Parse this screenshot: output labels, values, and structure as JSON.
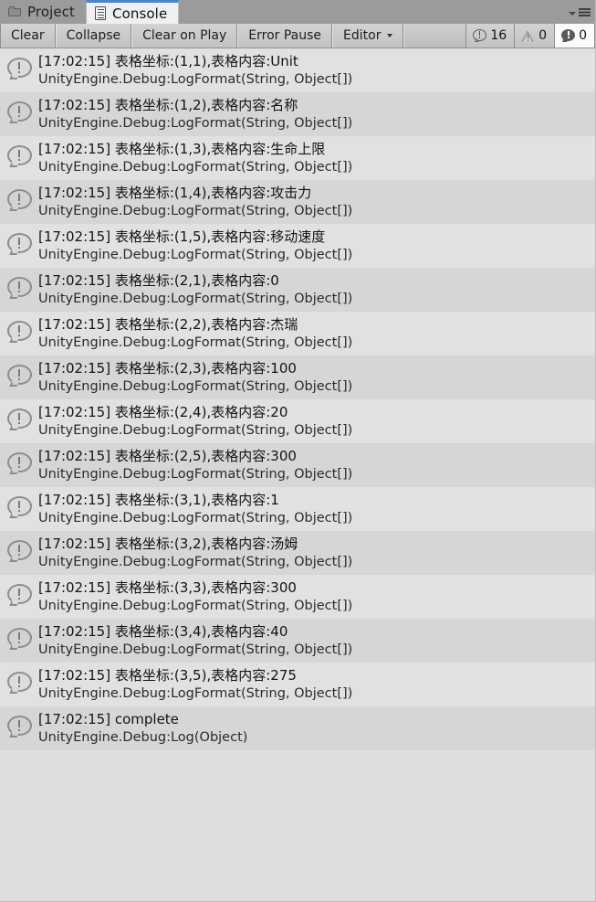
{
  "window": {
    "tabs": [
      {
        "label": "Project",
        "icon": "folder-icon",
        "active": false
      },
      {
        "label": "Console",
        "icon": "console-document-icon",
        "active": true
      }
    ],
    "tab_menu_icon": "hamburger-menu-icon"
  },
  "toolbar": {
    "clear_label": "Clear",
    "collapse_label": "Collapse",
    "clear_on_play_label": "Clear on Play",
    "error_pause_label": "Error Pause",
    "editor_label": "Editor",
    "counters": {
      "info_count": "16",
      "warning_count": "0",
      "error_count": "0"
    }
  },
  "console": {
    "entries": [
      {
        "message": "[17:02:15] 表格坐标:(1,1),表格内容:Unit",
        "stack": "UnityEngine.Debug:LogFormat(String, Object[])"
      },
      {
        "message": "[17:02:15] 表格坐标:(1,2),表格内容:名称",
        "stack": "UnityEngine.Debug:LogFormat(String, Object[])"
      },
      {
        "message": "[17:02:15] 表格坐标:(1,3),表格内容:生命上限",
        "stack": "UnityEngine.Debug:LogFormat(String, Object[])"
      },
      {
        "message": "[17:02:15] 表格坐标:(1,4),表格内容:攻击力",
        "stack": "UnityEngine.Debug:LogFormat(String, Object[])"
      },
      {
        "message": "[17:02:15] 表格坐标:(1,5),表格内容:移动速度",
        "stack": "UnityEngine.Debug:LogFormat(String, Object[])"
      },
      {
        "message": "[17:02:15] 表格坐标:(2,1),表格内容:0",
        "stack": "UnityEngine.Debug:LogFormat(String, Object[])"
      },
      {
        "message": "[17:02:15] 表格坐标:(2,2),表格内容:杰瑞",
        "stack": "UnityEngine.Debug:LogFormat(String, Object[])"
      },
      {
        "message": "[17:02:15] 表格坐标:(2,3),表格内容:100",
        "stack": "UnityEngine.Debug:LogFormat(String, Object[])"
      },
      {
        "message": "[17:02:15] 表格坐标:(2,4),表格内容:20",
        "stack": "UnityEngine.Debug:LogFormat(String, Object[])"
      },
      {
        "message": "[17:02:15] 表格坐标:(2,5),表格内容:300",
        "stack": "UnityEngine.Debug:LogFormat(String, Object[])"
      },
      {
        "message": "[17:02:15] 表格坐标:(3,1),表格内容:1",
        "stack": "UnityEngine.Debug:LogFormat(String, Object[])"
      },
      {
        "message": "[17:02:15] 表格坐标:(3,2),表格内容:汤姆",
        "stack": "UnityEngine.Debug:LogFormat(String, Object[])"
      },
      {
        "message": "[17:02:15] 表格坐标:(3,3),表格内容:300",
        "stack": "UnityEngine.Debug:LogFormat(String, Object[])"
      },
      {
        "message": "[17:02:15] 表格坐标:(3,4),表格内容:40",
        "stack": "UnityEngine.Debug:LogFormat(String, Object[])"
      },
      {
        "message": "[17:02:15] 表格坐标:(3,5),表格内容:275",
        "stack": "UnityEngine.Debug:LogFormat(String, Object[])"
      },
      {
        "message": "[17:02:15] complete",
        "stack": "UnityEngine.Debug:Log(Object)"
      }
    ]
  },
  "colors": {
    "tabbar_bg": "#9b9b9b",
    "active_tab_accent": "#4a83cf",
    "toolbar_bg": "#aeaeae",
    "row_even": "#e1e1e1",
    "row_odd": "#d6d6d6",
    "empty_bg": "#dedede"
  }
}
